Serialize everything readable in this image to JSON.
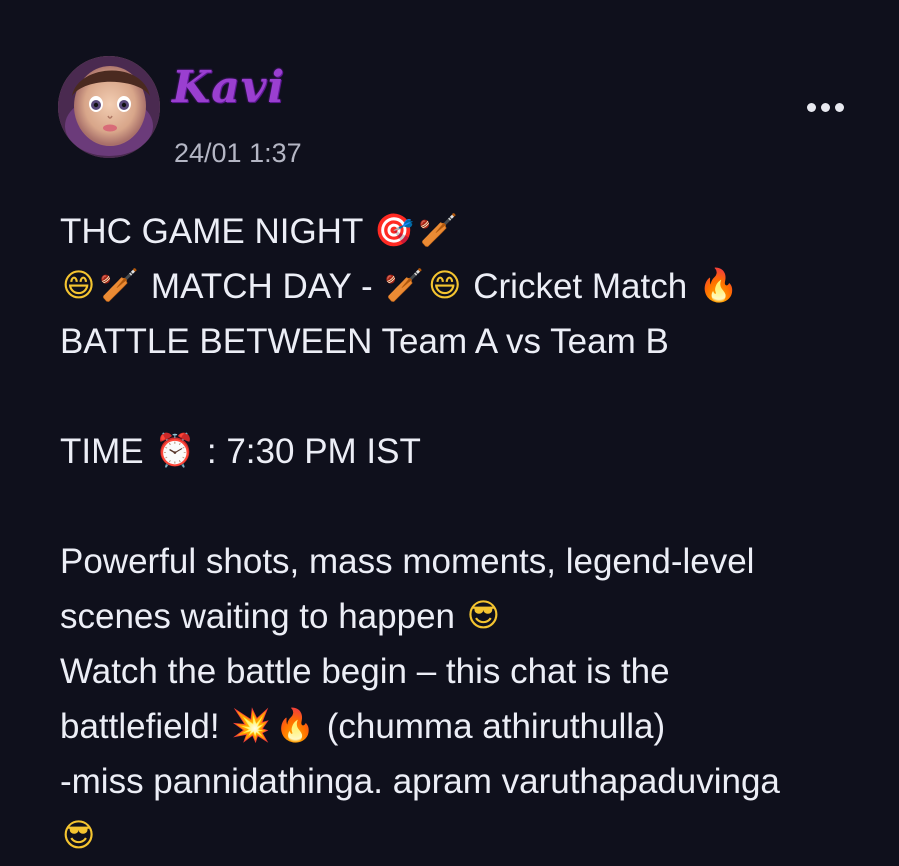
{
  "post": {
    "author": "Kavi",
    "timestamp": "24/01 1:37",
    "avatar": "avatar",
    "more_icon": "more-dots-icon",
    "lines": [
      {
        "segments": [
          {
            "t": "THC GAME NIGHT "
          },
          {
            "e": "🎯",
            "cls": "target"
          },
          {
            "e": "🏏",
            "cls": "bat"
          }
        ]
      },
      {
        "segments": [
          {
            "e": "😄",
            "cls": "grin"
          },
          {
            "e": "🏏",
            "cls": "bat"
          },
          {
            "t": " MATCH DAY - "
          },
          {
            "e": "🏏",
            "cls": "bat"
          },
          {
            "e": "😄",
            "cls": "grin"
          },
          {
            "t": " Cricket Match "
          },
          {
            "e": "🔥",
            "cls": "fire"
          }
        ]
      },
      {
        "segments": [
          {
            "t": "BATTLE BETWEEN Team A vs Team B"
          }
        ]
      },
      {
        "blank": true
      },
      {
        "segments": [
          {
            "t": "TIME "
          },
          {
            "e": "⏰",
            "cls": "clock"
          },
          {
            "t": " : 7:30 PM IST"
          }
        ]
      },
      {
        "blank": true
      },
      {
        "segments": [
          {
            "t": "Powerful shots, mass moments, legend-level"
          }
        ]
      },
      {
        "segments": [
          {
            "t": "scenes waiting to happen "
          },
          {
            "e": "😎",
            "cls": "cool"
          }
        ]
      },
      {
        "segments": [
          {
            "t": "Watch the battle begin – this chat is the"
          }
        ]
      },
      {
        "segments": [
          {
            "t": "battlefield! "
          },
          {
            "e": "💥",
            "cls": "boom"
          },
          {
            "e": "🔥",
            "cls": "fire"
          },
          {
            "t": " (chumma athiruthulla)"
          }
        ]
      },
      {
        "segments": [
          {
            "t": "-miss pannidathinga. apram varuthapaduvinga"
          }
        ]
      },
      {
        "segments": [
          {
            "e": "😎",
            "cls": "cool"
          }
        ]
      }
    ]
  }
}
